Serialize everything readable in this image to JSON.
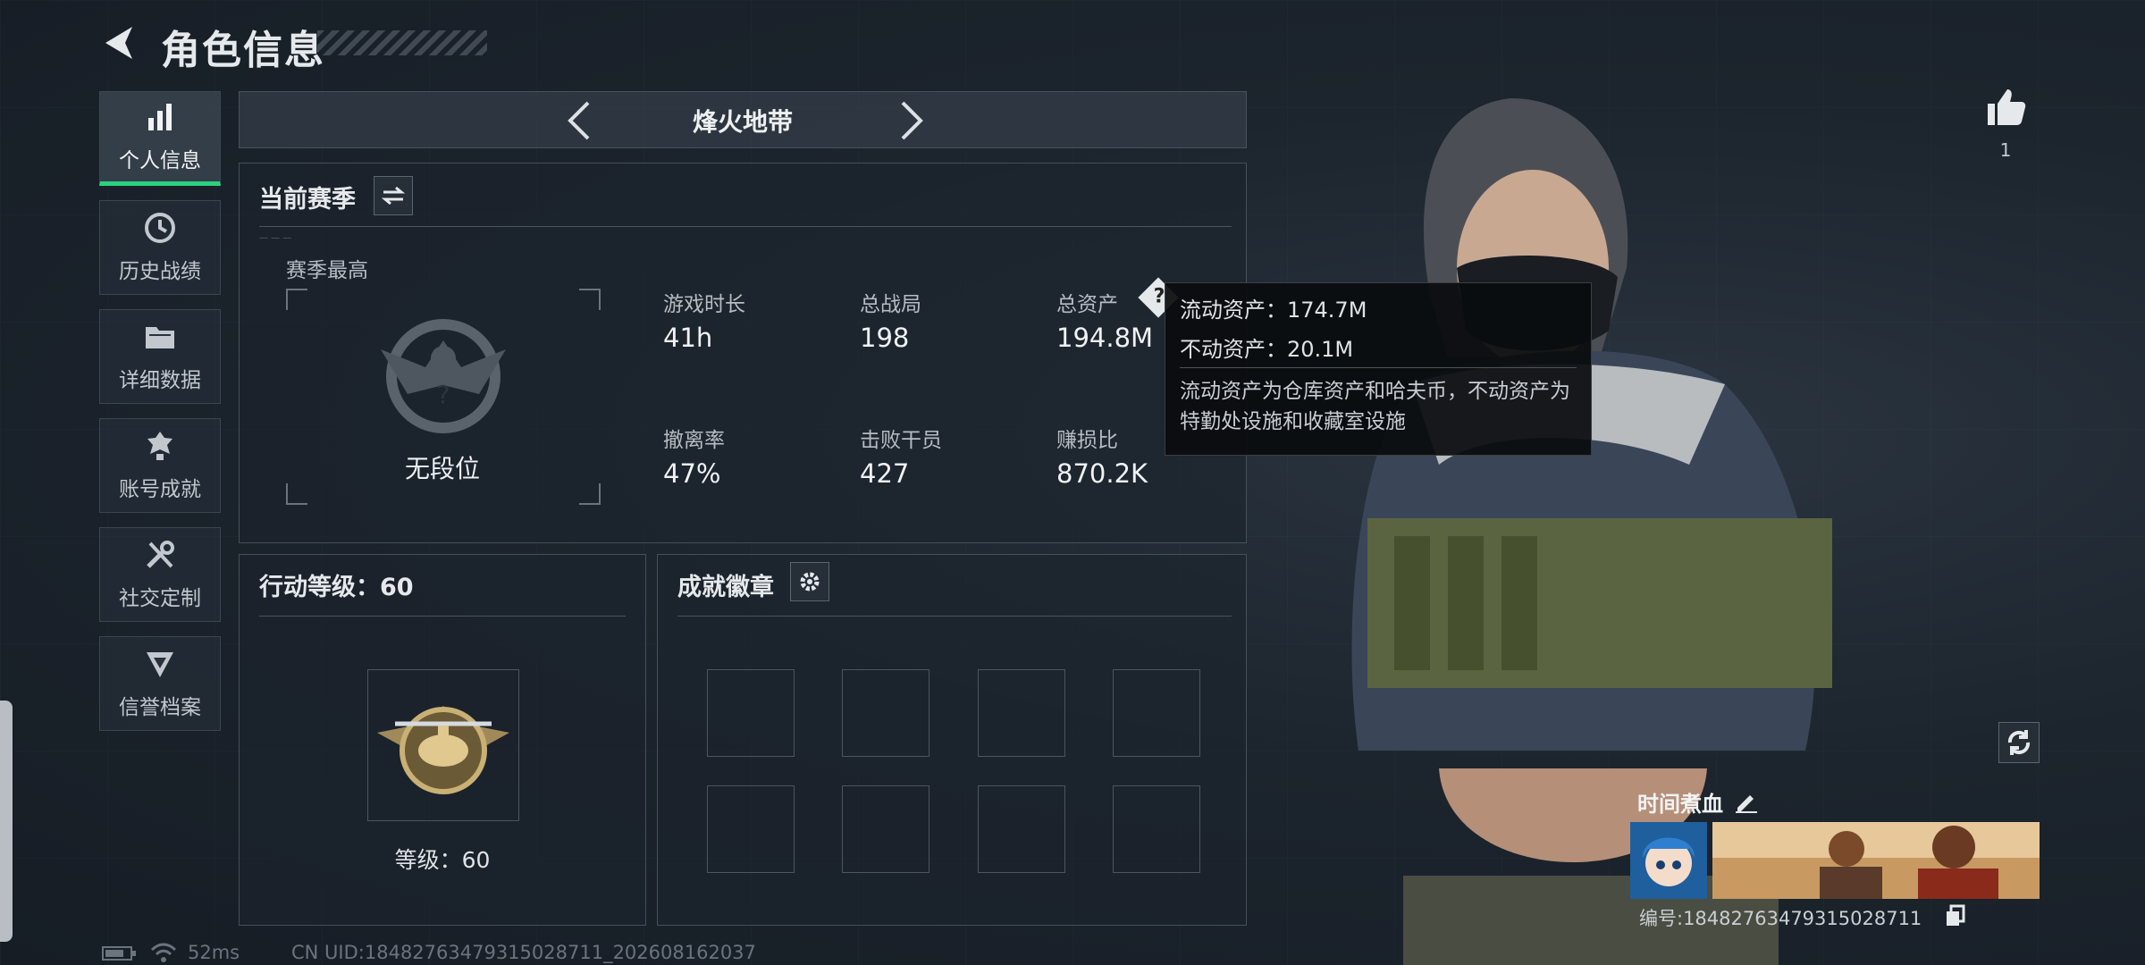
{
  "header": {
    "title": "角色信息"
  },
  "sidebar": {
    "items": [
      {
        "label": "个人信息",
        "icon": "bar-chart-icon",
        "active": true
      },
      {
        "label": "历史战绩",
        "icon": "history-clock-icon"
      },
      {
        "label": "详细数据",
        "icon": "folder-icon"
      },
      {
        "label": "账号成就",
        "icon": "achievement-icon"
      },
      {
        "label": "社交定制",
        "icon": "tools-icon"
      },
      {
        "label": "信誉档案",
        "icon": "credit-badge-icon"
      }
    ]
  },
  "mode_selector": {
    "name": "烽火地带"
  },
  "season": {
    "title": "当前赛季",
    "best_label": "赛季最高",
    "rank": "无段位",
    "stats": [
      {
        "label": "游戏时长",
        "value": "41h"
      },
      {
        "label": "总战局",
        "value": "198"
      },
      {
        "label": "总资产",
        "value": "194.8M"
      },
      {
        "label": "撤离率",
        "value": "47%"
      },
      {
        "label": "击败干员",
        "value": "427"
      },
      {
        "label": "赚损比",
        "value": "870.2K"
      }
    ]
  },
  "tooltip": {
    "liquid": "流动资产：174.7M",
    "fixed": "不动资产：20.1M",
    "note": "流动资产为仓库资产和哈夫币，不动资产为特勤处设施和收藏室设施"
  },
  "action_level": {
    "title": "行动等级：60",
    "level_text": "等级：60"
  },
  "achievement_badges": {
    "title": "成就徽章"
  },
  "profile": {
    "likes": "1",
    "nickname": "时间煮血",
    "id_text": "编号:18482763479315028711"
  },
  "status_bar": {
    "ping": "52ms",
    "uid": "CN UID:18482763479315028711_202608162037"
  },
  "colors": {
    "accent": "#29d27f",
    "panel_border": "#45505a",
    "background": "#1c242d"
  }
}
